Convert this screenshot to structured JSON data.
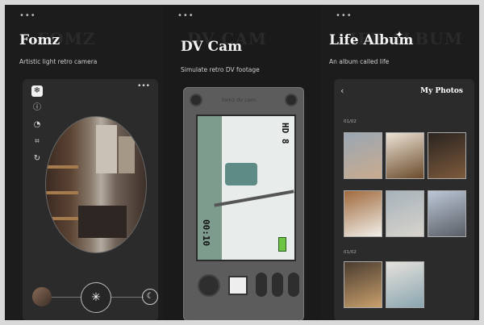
{
  "panels": [
    {
      "title": "Fomz",
      "subtitle": "Artistic light retro camera",
      "dots": "•••",
      "ghost": "FOMZ"
    },
    {
      "title": "DV Cam",
      "subtitle": "Simulate retro DV footage",
      "dots": "•••",
      "ghost": "DV CAM"
    },
    {
      "title": "Life Album",
      "subtitle": "An album called life",
      "dots": "•••",
      "ghost": "LIFE ALBUM",
      "sparkle": "✦"
    }
  ],
  "fomz": {
    "more": "•••",
    "shutter_icon": "✳",
    "moon_icon": "☾",
    "tools": [
      "❄",
      "ⓘ",
      "◔",
      "⌗",
      "↻"
    ]
  },
  "dvcam": {
    "camera_text": "fomz dv cam",
    "osd_left": "00:10",
    "osd_top": "HD 8"
  },
  "album": {
    "back": "‹",
    "header": "My Photos",
    "date_1": "01/02",
    "date_2": "01/02"
  },
  "colors": {
    "background": "#1a1a1a",
    "accent": "#6ec443"
  }
}
